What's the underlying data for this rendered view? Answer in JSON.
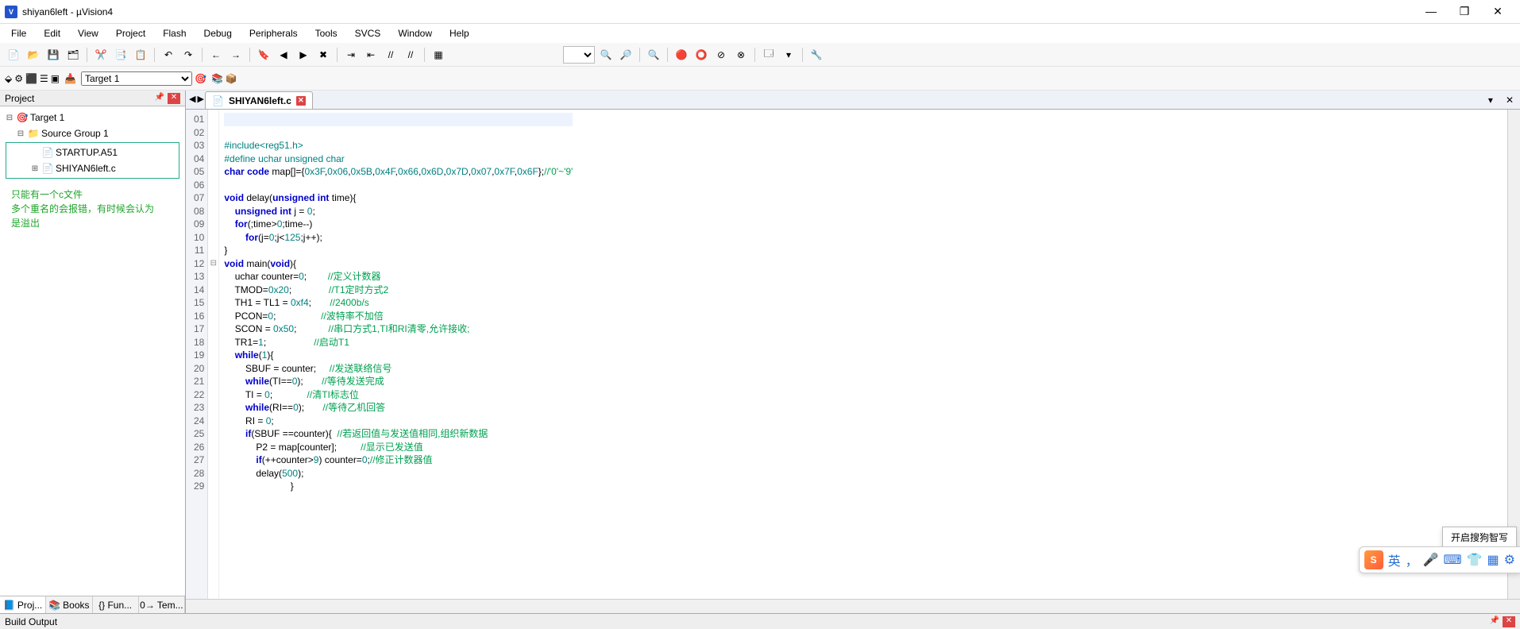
{
  "window": {
    "title": "shiyan6left - µVision4"
  },
  "menu": [
    "File",
    "Edit",
    "View",
    "Project",
    "Flash",
    "Debug",
    "Peripherals",
    "Tools",
    "SVCS",
    "Window",
    "Help"
  ],
  "toolbar2": {
    "target_combo": "Target 1"
  },
  "project_panel": {
    "title": "Project",
    "tree": {
      "root": {
        "label": "Target 1",
        "icon": "🎯"
      },
      "group": {
        "label": "Source Group 1",
        "icon": "📁"
      },
      "file1": {
        "label": "STARTUP.A51",
        "icon": "📄"
      },
      "file2": {
        "label": "SHIYAN6left.c",
        "icon": "📄"
      }
    },
    "note_line1": "只能有一个c文件",
    "note_line2": "多个重名的会报错，有时候会认为",
    "note_line3": "是溢出",
    "tabs": [
      "Proj...",
      "Books",
      "{} Fun...",
      "0→ Tem..."
    ]
  },
  "editor": {
    "tab_label": "SHIYAN6left.c",
    "lines": [
      {
        "n": "01",
        "html": ""
      },
      {
        "n": "02",
        "html": ""
      },
      {
        "n": "03",
        "html": "<span class='pp'>#include&lt;reg51.h&gt;</span>"
      },
      {
        "n": "04",
        "html": "<span class='pp'>#define uchar unsigned char</span>"
      },
      {
        "n": "05",
        "html": "<span class='k'>char</span> <span class='k'>code</span> map[]={<span class='num'>0x3F</span>,<span class='num'>0x06</span>,<span class='num'>0x5B</span>,<span class='num'>0x4F</span>,<span class='num'>0x66</span>,<span class='num'>0x6D</span>,<span class='num'>0x7D</span>,<span class='num'>0x07</span>,<span class='num'>0x7F</span>,<span class='num'>0x6F</span>};<span class='cm'>//'0'~'9'</span>"
      },
      {
        "n": "06",
        "html": ""
      },
      {
        "n": "07",
        "html": "<span class='k'>void</span> delay(<span class='k'>unsigned</span> <span class='k'>int</span> time){"
      },
      {
        "n": "08",
        "html": "    <span class='k'>unsigned</span> <span class='k'>int</span> j = <span class='num'>0</span>;"
      },
      {
        "n": "09",
        "html": "    <span class='k'>for</span>(;time&gt;<span class='num'>0</span>;time--)"
      },
      {
        "n": "10",
        "html": "        <span class='k'>for</span>(j=<span class='num'>0</span>;j&lt;<span class='num'>125</span>;j++);"
      },
      {
        "n": "11",
        "html": "}"
      },
      {
        "n": "12",
        "html": "<span class='k'>void</span> main(<span class='k'>void</span>){"
      },
      {
        "n": "13",
        "html": "    uchar counter=<span class='num'>0</span>;        <span class='cm'>//定义计数器</span>"
      },
      {
        "n": "14",
        "html": "    TMOD=<span class='num'>0x20</span>;              <span class='cm'>//T1定时方式2</span>"
      },
      {
        "n": "15",
        "html": "    TH1 = TL1 = <span class='num'>0xf4</span>;       <span class='cm'>//2400b/s</span>"
      },
      {
        "n": "16",
        "html": "    PCON=<span class='num'>0</span>;                 <span class='cm'>//波特率不加倍</span>"
      },
      {
        "n": "17",
        "html": "    SCON = <span class='num'>0x50</span>;            <span class='cm'>//串口方式1,TI和RI清零,允许接收;</span>"
      },
      {
        "n": "18",
        "html": "    TR1=<span class='num'>1</span>;                  <span class='cm'>//启动T1</span>"
      },
      {
        "n": "19",
        "html": "    <span class='k'>while</span>(<span class='num'>1</span>){"
      },
      {
        "n": "20",
        "html": "        SBUF = counter;     <span class='cm'>//发送联络信号</span>"
      },
      {
        "n": "21",
        "html": "        <span class='k'>while</span>(TI==<span class='num'>0</span>);       <span class='cm'>//等待发送完成</span>"
      },
      {
        "n": "22",
        "html": "        TI = <span class='num'>0</span>;             <span class='cm'>//清TI标志位</span>"
      },
      {
        "n": "23",
        "html": "        <span class='k'>while</span>(RI==<span class='num'>0</span>);       <span class='cm'>//等待乙机回答</span>"
      },
      {
        "n": "24",
        "html": "        RI = <span class='num'>0</span>;"
      },
      {
        "n": "25",
        "html": "        <span class='k'>if</span>(SBUF ==counter){  <span class='cm'>//若返回值与发送值相同,组织新数据</span>"
      },
      {
        "n": "26",
        "html": "            P2 = map[counter];         <span class='cm'>//显示已发送值</span>"
      },
      {
        "n": "27",
        "html": "            <span class='k'>if</span>(++counter&gt;<span class='num'>9</span>) counter=<span class='num'>0</span>;<span class='cm'>//修正计数器值</span>"
      },
      {
        "n": "28",
        "html": "            delay(<span class='num'>500</span>);"
      },
      {
        "n": "29",
        "html": "                         }"
      }
    ],
    "fold": {
      "1": "⊟",
      "7": "⊟",
      "12": "⊟"
    }
  },
  "build_output": {
    "title": "Build Output"
  },
  "ime": {
    "tip": "开启搜狗智写",
    "lang": "英"
  }
}
